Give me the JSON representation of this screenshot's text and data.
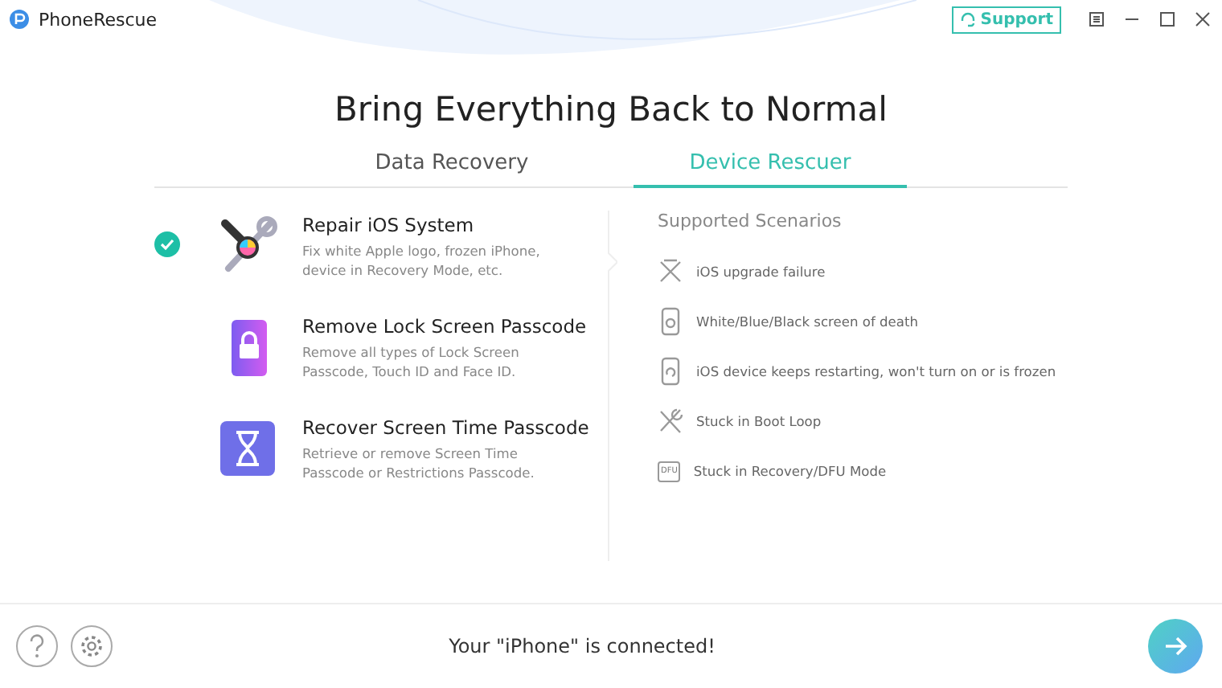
{
  "window": {
    "title": "PhoneRescue",
    "support": "Support"
  },
  "headline": "Bring Everything Back to Normal",
  "tabs": [
    {
      "label": "Data Recovery",
      "selected": false
    },
    {
      "label": "Device Rescuer",
      "selected": true
    }
  ],
  "modes": [
    {
      "kind": "repair",
      "title": "Repair iOS System",
      "description": "Fix white Apple logo, frozen iPhone, device in Recovery Mode, etc.",
      "selected": true
    },
    {
      "kind": "lock",
      "title": "Remove Lock Screen Passcode",
      "description": "Remove all types of Lock Screen Passcode, Touch ID and Face ID.",
      "selected": false
    },
    {
      "kind": "hourglass",
      "title": "Recover Screen Time Passcode",
      "description": "Retrieve or remove Screen Time Passcode or Restrictions Passcode.",
      "selected": false
    }
  ],
  "scenarios": {
    "title": "Supported Scenarios",
    "items": [
      {
        "kind": "cross",
        "text": "iOS upgrade failure"
      },
      {
        "kind": "phone",
        "text": "White/Blue/Black screen of death"
      },
      {
        "kind": "restart",
        "text": "iOS device keeps restarting, won't turn on or is frozen"
      },
      {
        "kind": "tools",
        "text": "Stuck in Boot Loop"
      },
      {
        "kind": "label",
        "icon_label": "DFU",
        "text": "Stuck in Recovery/DFU Mode"
      }
    ]
  },
  "status": "Your \"iPhone\" is connected!"
}
